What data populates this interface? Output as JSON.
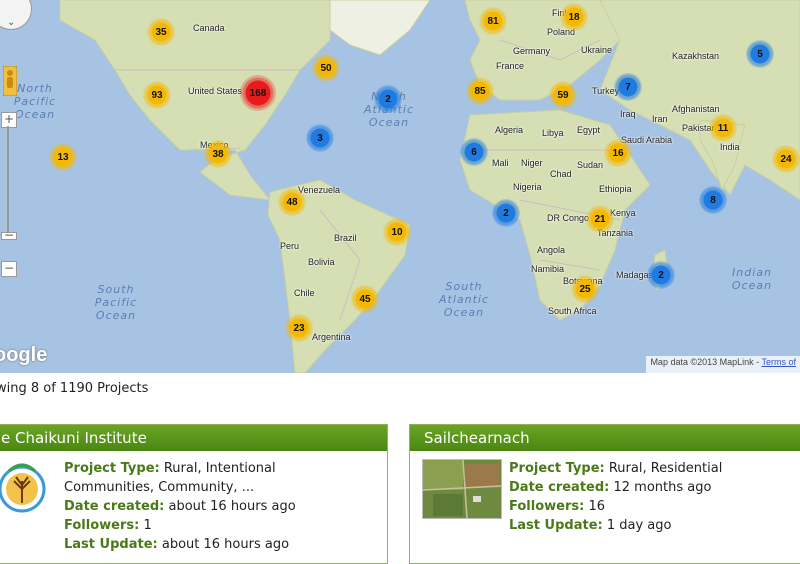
{
  "map": {
    "countries": [
      {
        "name": "Canada"
      },
      {
        "name": "United States"
      },
      {
        "name": "Mexico"
      },
      {
        "name": "Venezuela"
      },
      {
        "name": "Brazil"
      },
      {
        "name": "Peru"
      },
      {
        "name": "Bolivia"
      },
      {
        "name": "Chile"
      },
      {
        "name": "Argentina"
      },
      {
        "name": "Finland"
      },
      {
        "name": "Poland"
      },
      {
        "name": "Germany"
      },
      {
        "name": "Ukraine"
      },
      {
        "name": "France"
      },
      {
        "name": "Kazakhstan"
      },
      {
        "name": "Turkey"
      },
      {
        "name": "Iraq"
      },
      {
        "name": "Iran"
      },
      {
        "name": "Afghanistan"
      },
      {
        "name": "Pakistan"
      },
      {
        "name": "India"
      },
      {
        "name": "Algeria"
      },
      {
        "name": "Libya"
      },
      {
        "name": "Egypt"
      },
      {
        "name": "Saudi Arabia"
      },
      {
        "name": "Mali"
      },
      {
        "name": "Niger"
      },
      {
        "name": "Chad"
      },
      {
        "name": "Sudan"
      },
      {
        "name": "Nigeria"
      },
      {
        "name": "Ethiopia"
      },
      {
        "name": "DR Congo"
      },
      {
        "name": "Kenya"
      },
      {
        "name": "Tanzania"
      },
      {
        "name": "Angola"
      },
      {
        "name": "Namibia"
      },
      {
        "name": "Botswana"
      },
      {
        "name": "South Africa"
      },
      {
        "name": "Madagascar"
      }
    ],
    "oceans": [
      {
        "l1": "North",
        "l2": "Pacific",
        "l3": "Ocean"
      },
      {
        "l1": "North",
        "l2": "Atlantic",
        "l3": "Ocean"
      },
      {
        "l1": "South",
        "l2": "Pacific",
        "l3": "Ocean"
      },
      {
        "l1": "South",
        "l2": "Atlantic",
        "l3": "Ocean"
      },
      {
        "l1": "Indian",
        "l2": "Ocean",
        "l3": ""
      }
    ],
    "clusters": [
      {
        "count": "35",
        "color": "yellow"
      },
      {
        "count": "93",
        "color": "yellow"
      },
      {
        "count": "168",
        "color": "red"
      },
      {
        "count": "50",
        "color": "yellow"
      },
      {
        "count": "2",
        "color": "blue"
      },
      {
        "count": "3",
        "color": "blue"
      },
      {
        "count": "13",
        "color": "yellow"
      },
      {
        "count": "38",
        "color": "yellow"
      },
      {
        "count": "48",
        "color": "yellow"
      },
      {
        "count": "10",
        "color": "yellow"
      },
      {
        "count": "45",
        "color": "yellow"
      },
      {
        "count": "23",
        "color": "yellow"
      },
      {
        "count": "81",
        "color": "yellow"
      },
      {
        "count": "18",
        "color": "yellow"
      },
      {
        "count": "85",
        "color": "yellow"
      },
      {
        "count": "59",
        "color": "yellow"
      },
      {
        "count": "7",
        "color": "blue"
      },
      {
        "count": "5",
        "color": "blue"
      },
      {
        "count": "6",
        "color": "blue"
      },
      {
        "count": "16",
        "color": "yellow"
      },
      {
        "count": "11",
        "color": "yellow"
      },
      {
        "count": "24",
        "color": "yellow"
      },
      {
        "count": "8",
        "color": "blue"
      },
      {
        "count": "2",
        "color": "blue"
      },
      {
        "count": "21",
        "color": "yellow"
      },
      {
        "count": "25",
        "color": "yellow"
      },
      {
        "count": "2",
        "color": "blue"
      }
    ],
    "attribution": "Map data ©2013 MapLink - ",
    "terms_link": "Terms of",
    "logo": "oogle",
    "colors": {
      "water": "#a6c3e4",
      "land": "#d9e2b8",
      "cluster_yellow": "#f5b800",
      "cluster_blue": "#1f7be0",
      "cluster_red": "#e81a1a"
    }
  },
  "summary": "wing 8 of 1190 Projects",
  "cards": [
    {
      "title": "e Chaikuni Institute",
      "rows": [
        {
          "label": "Project Type:",
          "value": " Rural, Intentional"
        },
        {
          "label": "",
          "value": "Communities, Community, ..."
        },
        {
          "label": "Date created:",
          "value": " about 16 hours ago"
        },
        {
          "label": "Followers:",
          "value": " 1"
        },
        {
          "label": "Last Update:",
          "value": " about 16 hours ago"
        }
      ]
    },
    {
      "title": "Sailchearnach",
      "rows": [
        {
          "label": "Project Type:",
          "value": " Rural, Residential"
        },
        {
          "label": "Date created:",
          "value": " 12 months ago"
        },
        {
          "label": "Followers:",
          "value": " 16"
        },
        {
          "label": "Last Update:",
          "value": " 1 day ago"
        }
      ]
    }
  ],
  "accent_green": "#5a9a1a"
}
